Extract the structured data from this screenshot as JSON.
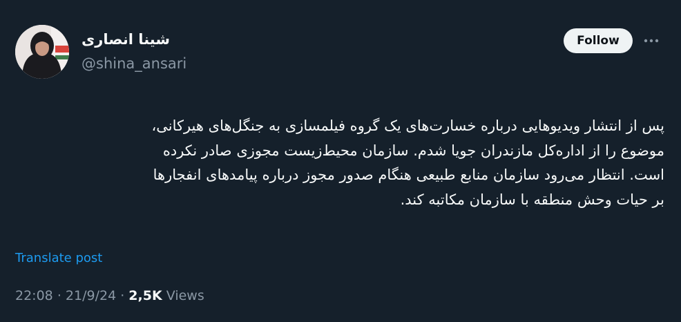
{
  "author": {
    "display_name": "شینا انصاری",
    "handle": "@shina_ansari",
    "avatar": "profile-photo"
  },
  "actions": {
    "follow_label": "Follow",
    "more_icon": "more-horizontal-icon"
  },
  "tweet": {
    "lines": [
      "پس از انتشار ویدیوهایی درباره خسارت‌های یک گروه فیلمسازی به جنگل‌های هیرکانی،",
      "موضوع را از اداره‌کل مازندران جویا شدم. سازمان محیط‌زیست مجوزی صادر نکرده",
      "است. انتظار می‌رود سازمان منابع طبیعی هنگام صدور مجوز درباره پیامدهای انفجارها",
      "بر حیات وحش منطقه با سازمان مکاتبه کند."
    ]
  },
  "translate_label": "Translate post",
  "meta": {
    "time": "22:08",
    "separator": "·",
    "date": "21/9/24",
    "views_count": "2,5K",
    "views_label": "Views"
  },
  "colors": {
    "background": "#15202b",
    "text": "#f7f9f9",
    "secondary": "#8b98a5",
    "link": "#1d9bf0",
    "follow_bg": "#eff3f4"
  }
}
